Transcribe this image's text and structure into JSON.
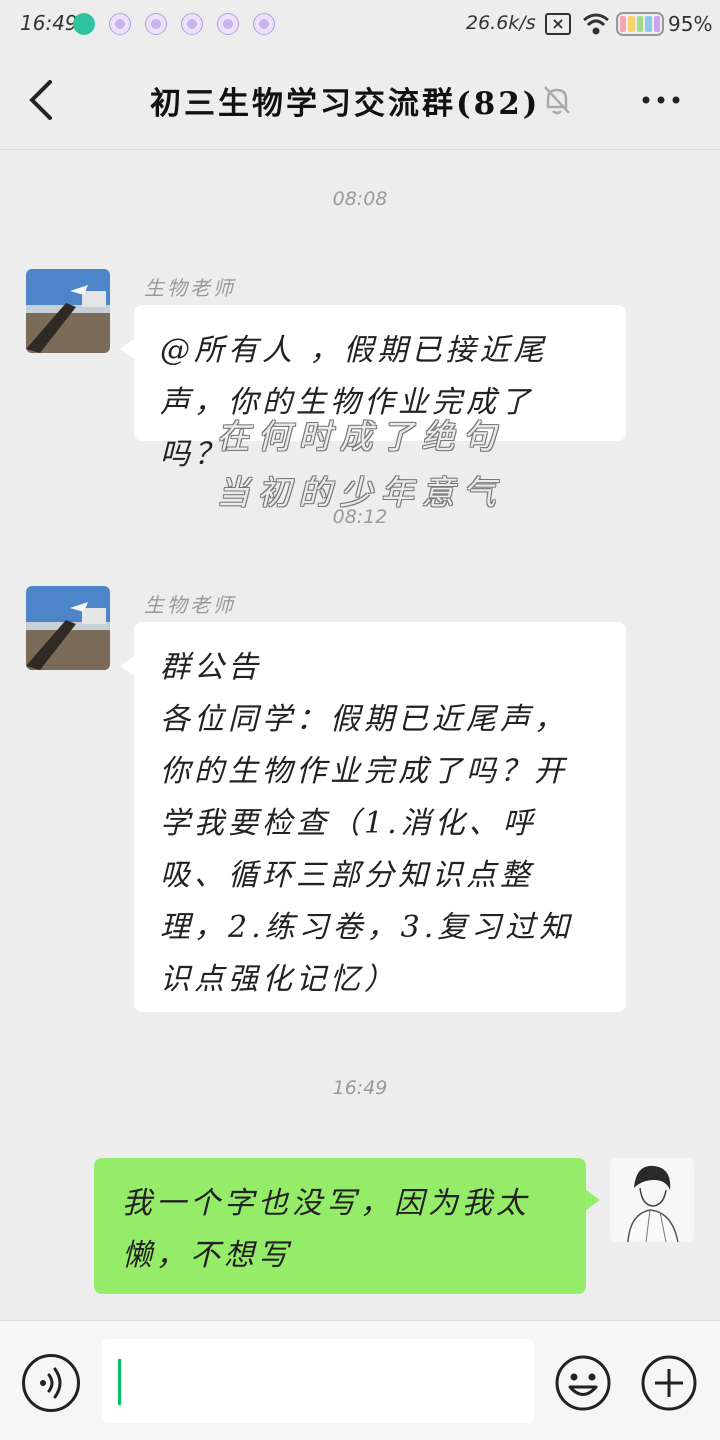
{
  "status_bar": {
    "time": "16:49",
    "net_speed": "26.6k/s",
    "battery_pct": "95%",
    "battery_level": 0.95
  },
  "header": {
    "title": "初三生物学习交流群(82)",
    "back_icon": "chevron-left-icon",
    "mute_icon": "bell-off-icon",
    "more_icon": "more-dots-icon"
  },
  "messages": {
    "ts1": "08:08",
    "msg1": {
      "sender": "生物老师",
      "text": "@所有人 ，假期已接近尾声，你的生物作业完成了吗？"
    },
    "ts2": "08:12",
    "msg2": {
      "sender": "生物老师",
      "text": "群公告\n各位同学：假期已近尾声，你的生物作业完成了吗？开学我要检查（1.消化、呼吸、循环三部分知识点整理，2.练习卷，3.复习过知识点强化记忆）"
    },
    "ts3": "16:49",
    "msg3": {
      "text": "我一个字也没写，因为我太懒，不想写"
    }
  },
  "overlay": {
    "line1": "在何时成了绝句",
    "line2": "当初的少年意气"
  },
  "input_bar": {
    "voice_icon": "voice-icon",
    "input_value": "",
    "emoji_icon": "emoji-icon",
    "plus_icon": "plus-icon"
  },
  "colors": {
    "background": "#ededed",
    "bubble_self": "#95ec69",
    "bubble_other": "#ffffff",
    "accent": "#07c160"
  }
}
